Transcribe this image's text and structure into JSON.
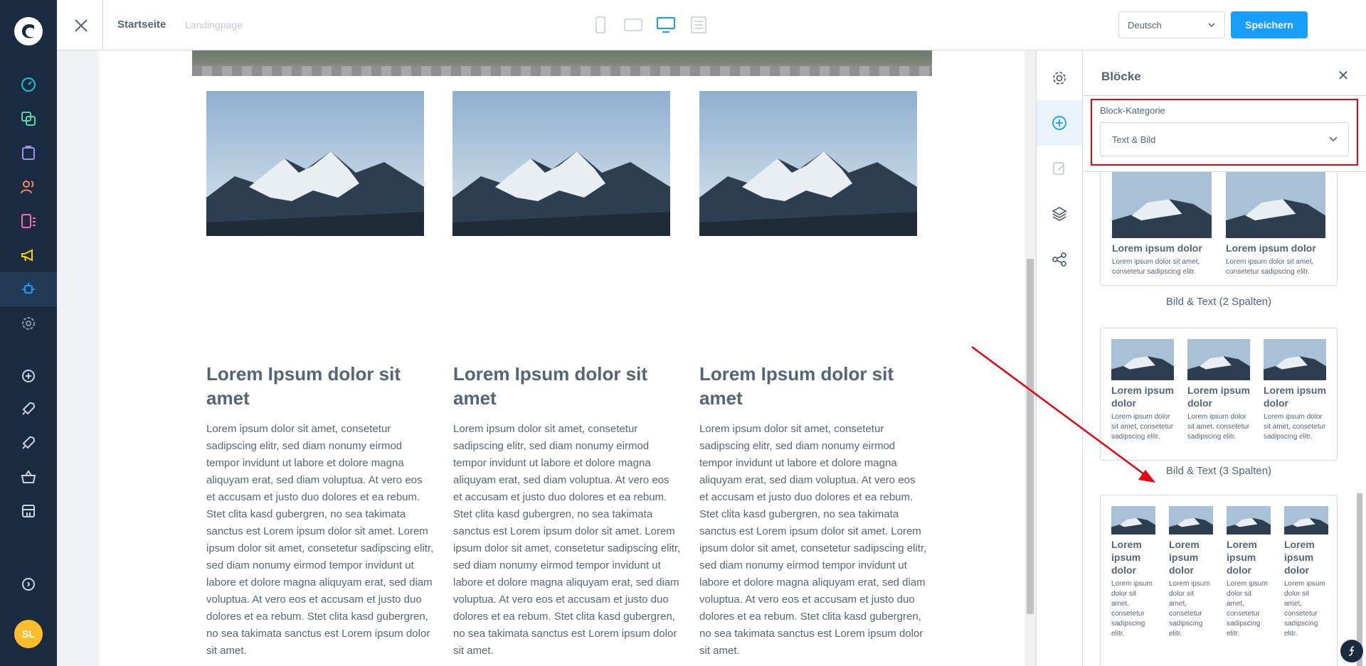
{
  "topbar": {
    "crumb_primary": "Startseite",
    "crumb_secondary": "Landingpage",
    "language": "Deutsch",
    "save_label": "Speichern"
  },
  "user": {
    "initials": "SL"
  },
  "columns": [
    {
      "title": "Lorem Ipsum dolor sit amet",
      "text": "Lorem ipsum dolor sit amet, consetetur sadipscing elitr, sed diam nonumy eirmod tempor invidunt ut labore et dolore magna aliquyam erat, sed diam voluptua. At vero eos et accusam et justo duo dolores et ea rebum. Stet clita kasd gubergren, no sea takimata sanctus est Lorem ipsum dolor sit amet. Lorem ipsum dolor sit amet, consetetur sadipscing elitr, sed diam nonumy eirmod tempor invidunt ut labore et dolore magna aliquyam erat, sed diam voluptua. At vero eos et accusam et justo duo dolores et ea rebum. Stet clita kasd gubergren, no sea takimata sanctus est Lorem ipsum dolor sit amet."
    },
    {
      "title": "Lorem Ipsum dolor sit amet",
      "text": "Lorem ipsum dolor sit amet, consetetur sadipscing elitr, sed diam nonumy eirmod tempor invidunt ut labore et dolore magna aliquyam erat, sed diam voluptua. At vero eos et accusam et justo duo dolores et ea rebum. Stet clita kasd gubergren, no sea takimata sanctus est Lorem ipsum dolor sit amet. Lorem ipsum dolor sit amet, consetetur sadipscing elitr, sed diam nonumy eirmod tempor invidunt ut labore et dolore magna aliquyam erat, sed diam voluptua. At vero eos et accusam et justo duo dolores et ea rebum. Stet clita kasd gubergren, no sea takimata sanctus est Lorem ipsum dolor sit amet."
    },
    {
      "title": "Lorem Ipsum dolor sit amet",
      "text": "Lorem ipsum dolor sit amet, consetetur sadipscing elitr, sed diam nonumy eirmod tempor invidunt ut labore et dolore magna aliquyam erat, sed diam voluptua. At vero eos et accusam et justo duo dolores et ea rebum. Stet clita kasd gubergren, no sea takimata sanctus est Lorem ipsum dolor sit amet. Lorem ipsum dolor sit amet, consetetur sadipscing elitr, sed diam nonumy eirmod tempor invidunt ut labore et dolore magna aliquyam erat, sed diam voluptua. At vero eos et accusam et justo duo dolores et ea rebum. Stet clita kasd gubergren, no sea takimata sanctus est Lorem ipsum dolor sit amet."
    }
  ],
  "blocks": {
    "title": "Blöcke",
    "category_label": "Block-Kategorie",
    "category_value": "Text & Bild",
    "card_title": "Lorem ipsum dolor",
    "card_text": "Lorem ipsum dolor sit amet, consetetur sadipscing elitr.",
    "items": [
      {
        "name": "Bild & Text (2 Spalten)"
      },
      {
        "name": "Bild & Text (3 Spalten)"
      }
    ]
  },
  "colors": {
    "nav_bg": "#1a2b41",
    "accent": "#189eff",
    "highlight": "#e30613",
    "avatar": "#ffbd2e"
  },
  "icons": {
    "nav": [
      "dashboard-icon",
      "products-icon",
      "orders-icon",
      "customers-icon",
      "content-icon",
      "marketing-icon",
      "extensions-icon",
      "settings-icon",
      "add-icon",
      "rocket-icon",
      "rocket-icon",
      "basket-icon",
      "store-icon",
      "help-icon"
    ],
    "rail": [
      "gear-icon",
      "plus-circle-icon",
      "edit-icon",
      "layers-icon",
      "share-icon"
    ]
  }
}
